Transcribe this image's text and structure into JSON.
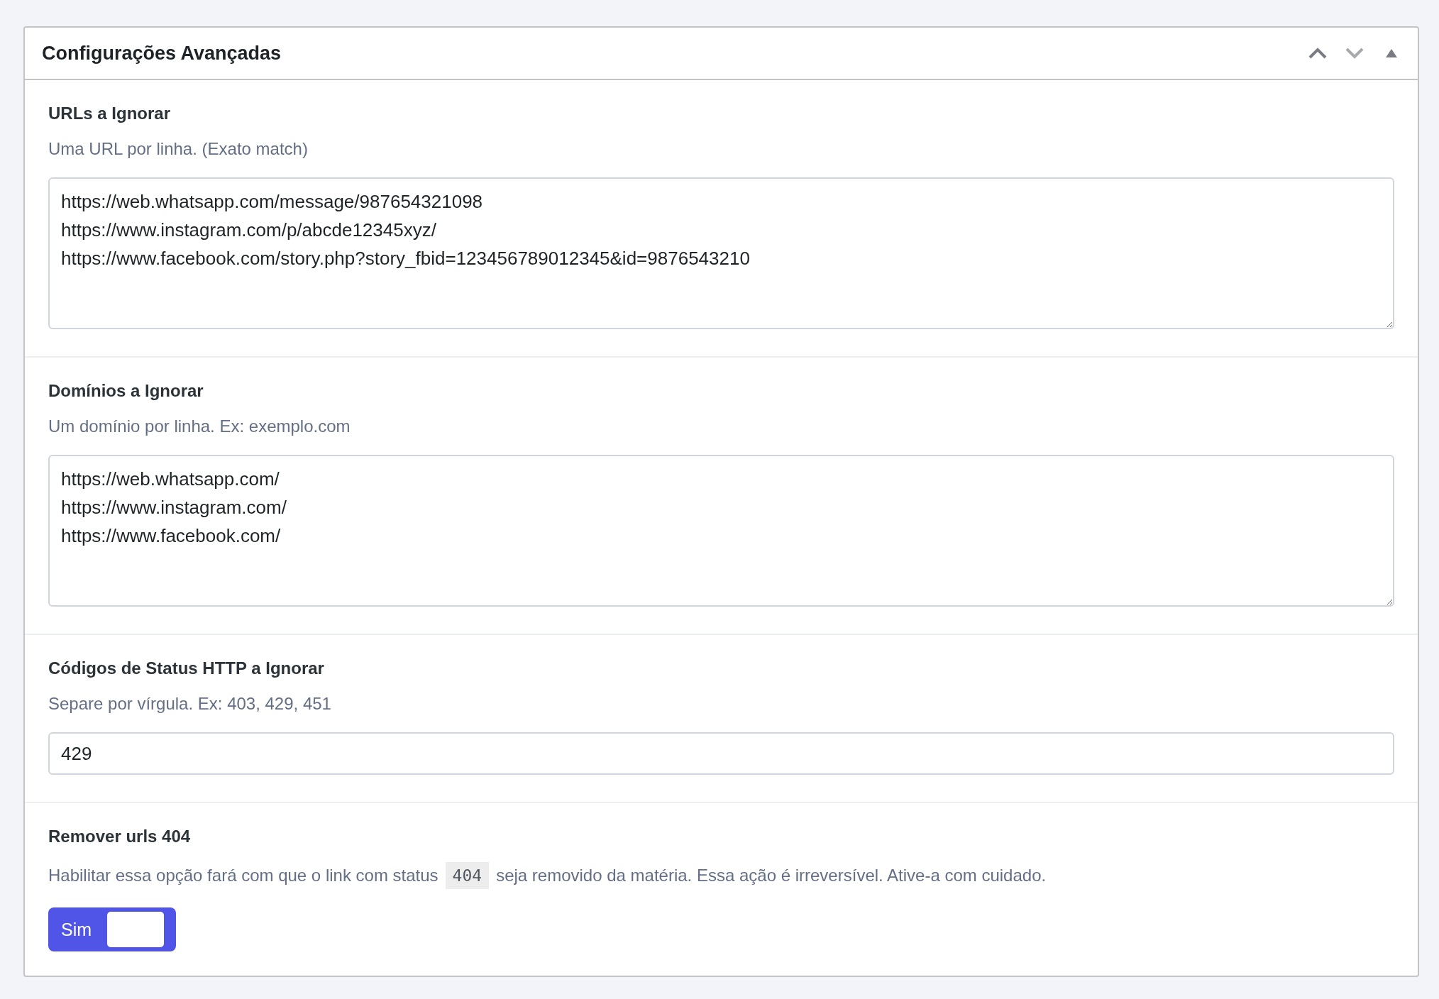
{
  "panel": {
    "title": "Configurações Avançadas",
    "controls": [
      {
        "kind": "up",
        "disabled": false
      },
      {
        "kind": "down",
        "disabled": true
      },
      {
        "kind": "collapse",
        "disabled": false
      }
    ]
  },
  "sections": [
    {
      "kind": "textarea",
      "label": "URLs a Ignorar",
      "description": "Uma URL por linha. (Exato match)",
      "lines": [
        "https://web.whatsapp.com/message/987654321098",
        "https://www.instagram.com/p/abcde12345xyz/",
        "https://www.facebook.com/story.php?story_fbid=123456789012345&id=9876543210"
      ]
    },
    {
      "kind": "textarea",
      "label": "Domínios a Ignorar",
      "description": "Um domínio por linha. Ex: exemplo.com",
      "lines": [
        "https://web.whatsapp.com/",
        "https://www.instagram.com/",
        "https://www.facebook.com/"
      ]
    },
    {
      "kind": "input",
      "label": "Códigos de Status HTTP a Ignorar",
      "description": "Separe por vírgula. Ex: 403, 429, 451",
      "value": "429"
    },
    {
      "kind": "toggle",
      "label": "Remover urls 404",
      "description_before": "Habilitar essa opção fará com que o link com status",
      "code": "404",
      "description_after": "seja removido da matéria. Essa ação é irreversível. Ative-a com cuidado.",
      "toggle": {
        "label": "Sim",
        "on": true
      }
    }
  ]
}
